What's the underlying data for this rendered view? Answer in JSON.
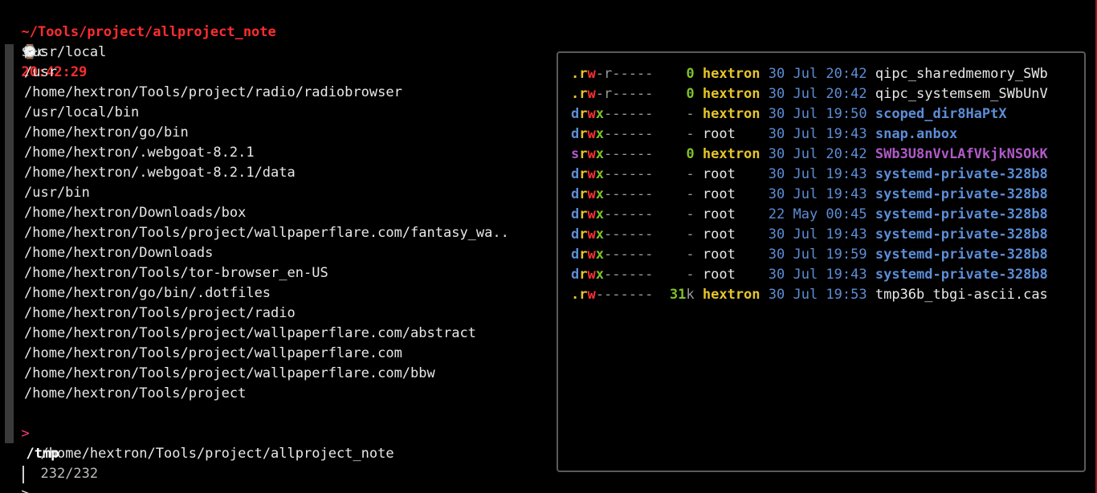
{
  "prompt": {
    "path": "~/Tools/project/allproject_note",
    "watch_icon": "⌚",
    "time": "20:42:29",
    "command_symbol": "$",
    "command": "c"
  },
  "list": {
    "items": [
      "/usr/local",
      "/usr",
      "/home/hextron/Tools/project/radio/radiobrowser",
      "/usr/local/bin",
      "/home/hextron/go/bin",
      "/home/hextron/.webgoat-8.2.1",
      "/home/hextron/.webgoat-8.2.1/data",
      "/usr/bin",
      "/home/hextron/Downloads/box",
      "/home/hextron/Tools/project/wallpaperflare.com/fantasy_wa..",
      "/home/hextron/Downloads",
      "/home/hextron/Tools/tor-browser_en-US",
      "/home/hextron/go/bin/.dotfiles",
      "/home/hextron/Tools/project/radio",
      "/home/hextron/Tools/project/wallpaperflare.com/abstract",
      "/home/hextron/Tools/project/wallpaperflare.com",
      "/home/hextron/Tools/project/wallpaperflare.com/bbw",
      "/home/hextron/Tools/project"
    ],
    "selected_marker": ">",
    "selected_item": "/tmp",
    "after_item": "/home/hextron/Tools/project/allproject_note",
    "count": "232/232",
    "query_prompt": ">"
  },
  "preview": {
    "rows": [
      {
        "type": ".",
        "r": "r",
        "w": "w",
        "rest": "-r-----",
        "size": "0",
        "owner": "hextron",
        "date": "30 Jul 20:42",
        "name": "qipc_sharedmemory_SWb",
        "kind": "file"
      },
      {
        "type": ".",
        "r": "r",
        "w": "w",
        "rest": "-r-----",
        "size": "0",
        "owner": "hextron",
        "date": "30 Jul 20:42",
        "name": "qipc_systemsem_SWbUnV",
        "kind": "file"
      },
      {
        "type": "d",
        "r": "r",
        "w": "w",
        "x": "x",
        "rest": "------",
        "size": "-",
        "owner": "hextron",
        "date": "30 Jul 19:50",
        "name": "scoped_dir8HaPtX",
        "kind": "dir"
      },
      {
        "type": "d",
        "r": "r",
        "w": "w",
        "x": "x",
        "rest": "------",
        "size": "-",
        "owner": "root",
        "date": "30 Jul 19:43",
        "name": "snap.anbox",
        "kind": "dir"
      },
      {
        "type": "s",
        "r": "r",
        "w": "w",
        "x": "x",
        "rest": "------",
        "size": "0",
        "owner": "hextron",
        "date": "30 Jul 20:42",
        "name": "SWb3U8nVvLAfVkjkNSOkK",
        "kind": "socket"
      },
      {
        "type": "d",
        "r": "r",
        "w": "w",
        "x": "x",
        "rest": "------",
        "size": "-",
        "owner": "root",
        "date": "30 Jul 19:43",
        "name": "systemd-private-328b8",
        "kind": "dir"
      },
      {
        "type": "d",
        "r": "r",
        "w": "w",
        "x": "x",
        "rest": "------",
        "size": "-",
        "owner": "root",
        "date": "30 Jul 19:43",
        "name": "systemd-private-328b8",
        "kind": "dir"
      },
      {
        "type": "d",
        "r": "r",
        "w": "w",
        "x": "x",
        "rest": "------",
        "size": "-",
        "owner": "root",
        "date": "22 May 00:45",
        "name": "systemd-private-328b8",
        "kind": "dir"
      },
      {
        "type": "d",
        "r": "r",
        "w": "w",
        "x": "x",
        "rest": "------",
        "size": "-",
        "owner": "root",
        "date": "30 Jul 19:43",
        "name": "systemd-private-328b8",
        "kind": "dir"
      },
      {
        "type": "d",
        "r": "r",
        "w": "w",
        "x": "x",
        "rest": "------",
        "size": "-",
        "owner": "root",
        "date": "30 Jul 19:59",
        "name": "systemd-private-328b8",
        "kind": "dir"
      },
      {
        "type": "d",
        "r": "r",
        "w": "w",
        "x": "x",
        "rest": "------",
        "size": "-",
        "owner": "root",
        "date": "30 Jul 19:43",
        "name": "systemd-private-328b8",
        "kind": "dir"
      },
      {
        "type": ".",
        "r": "r",
        "w": "w",
        "rest": "-------",
        "size": "31",
        "size_unit": "k",
        "owner": "hextron",
        "date": "30 Jul 19:53",
        "name": "tmp36b_tbgi-ascii.cas",
        "kind": "file"
      }
    ]
  },
  "colors": {
    "prompt_path": "#ff2d2d",
    "background": "#000000",
    "preview_border": "#5a5a5a",
    "selection_marker": "#ff3b7a",
    "owner": "#e5c52a",
    "size": "#7ec02a",
    "date": "#5c8dd6",
    "dir_name": "#5c8dd6",
    "socket_name": "#b05ac8"
  }
}
